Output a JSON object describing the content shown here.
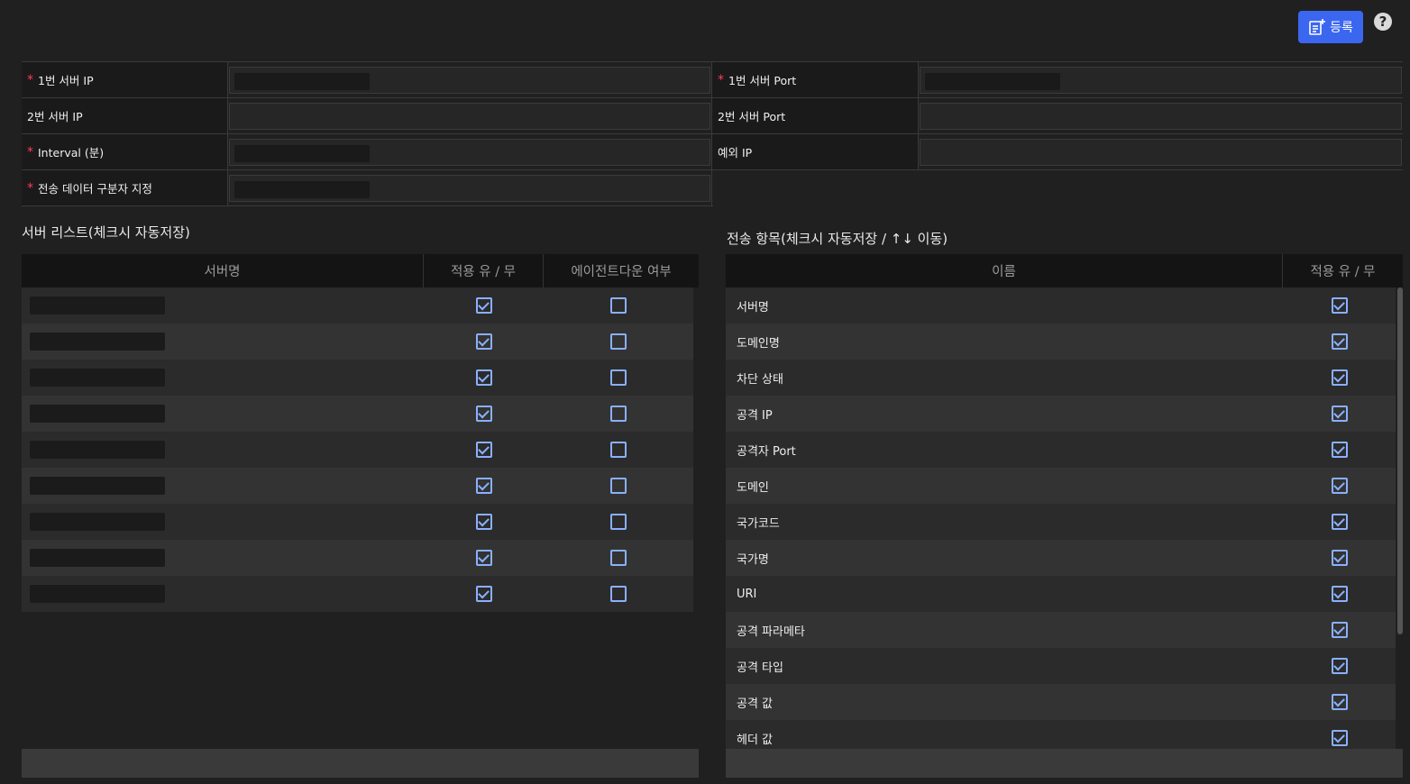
{
  "toolbar": {
    "register_label": "등록",
    "help_label": "?"
  },
  "form": {
    "server1_ip_label": "1번 서버 IP",
    "server1_port_label": "1번 서버 Port",
    "server2_ip_label": "2번 서버 IP",
    "server2_port_label": "2번 서버 Port",
    "interval_label": "Interval (분)",
    "exception_ip_label": "예외 IP",
    "delimiter_label": "전송 데이터 구분자 지정",
    "required_mark": "*"
  },
  "server_list": {
    "title": "서버 리스트(체크시 자동저장)",
    "columns": [
      "서버명",
      "적용 유 / 무",
      "에이전트다운 여부"
    ],
    "rows": [
      {
        "apply": true,
        "agent_down": false
      },
      {
        "apply": true,
        "agent_down": false
      },
      {
        "apply": true,
        "agent_down": false
      },
      {
        "apply": true,
        "agent_down": false
      },
      {
        "apply": true,
        "agent_down": false
      },
      {
        "apply": true,
        "agent_down": false
      },
      {
        "apply": true,
        "agent_down": false
      },
      {
        "apply": true,
        "agent_down": false
      },
      {
        "apply": true,
        "agent_down": false
      }
    ]
  },
  "transmit_items": {
    "title": "전송 항목(체크시 자동저장 / ↑↓ 이동)",
    "columns": [
      "이름",
      "적용 유 / 무"
    ],
    "rows": [
      {
        "name": "서버명",
        "apply": true
      },
      {
        "name": "도메인명",
        "apply": true
      },
      {
        "name": "차단 상태",
        "apply": true
      },
      {
        "name": "공격 IP",
        "apply": true
      },
      {
        "name": "공격자 Port",
        "apply": true
      },
      {
        "name": "도메인",
        "apply": true
      },
      {
        "name": "국가코드",
        "apply": true
      },
      {
        "name": "국가명",
        "apply": true
      },
      {
        "name": "URI",
        "apply": true
      },
      {
        "name": "공격 파라메타",
        "apply": true
      },
      {
        "name": "공격 타입",
        "apply": true
      },
      {
        "name": "공격 값",
        "apply": true
      },
      {
        "name": "헤더 값",
        "apply": true
      }
    ]
  },
  "colors": {
    "accent": "#3a66f0",
    "required": "#ff3b5c",
    "checkbox": "#8ab0ff"
  }
}
